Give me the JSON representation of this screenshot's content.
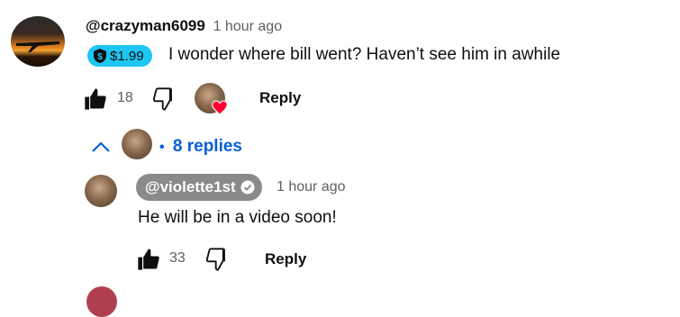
{
  "comment": {
    "author": "@crazyman6099",
    "time": "1 hour ago",
    "donation": "$1.99",
    "text": "I wonder where bill went? Haven’t see him in awhile",
    "like_count": "18",
    "reply_label": "Reply",
    "replies_label": "8 replies",
    "replies_separator": "•"
  },
  "reply": {
    "author": "@violette1st",
    "time": "1 hour ago",
    "text": "He will be in a video soon!",
    "like_count": "33",
    "reply_label": "Reply"
  },
  "colors": {
    "donation_bg": "#1ec6f2",
    "replies_link": "#065fd4",
    "author_pill_bg": "#8a8a8a",
    "heart": "#ff0033"
  },
  "icons": [
    "like-icon",
    "dislike-icon",
    "creator-heart-icon",
    "chevron-up-icon",
    "verified-check-icon",
    "donation-shield-icon"
  ]
}
